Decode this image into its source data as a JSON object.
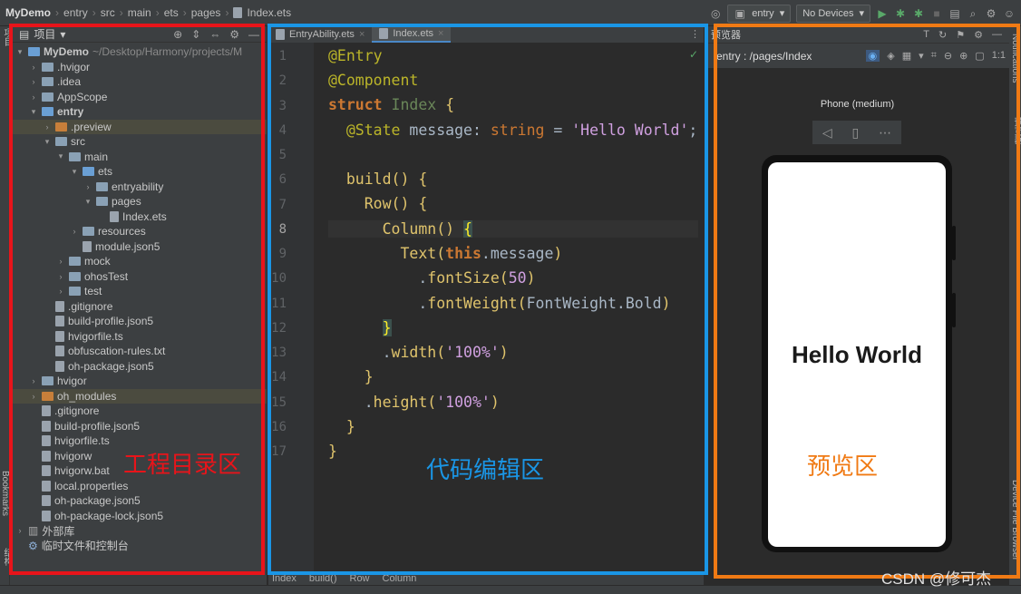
{
  "topbar": {
    "crumbs": [
      "MyDemo",
      "entry",
      "src",
      "main",
      "ets",
      "pages",
      "Index.ets"
    ],
    "run_config": "entry",
    "device": "No Devices"
  },
  "project": {
    "title": "项目",
    "tree": [
      {
        "label": "MyDemo",
        "extra": "~/Desktop/Harmony/projects/M",
        "depth": 0,
        "arrow": "down",
        "kind": "folder-blue",
        "bold": true
      },
      {
        "label": ".hvigor",
        "depth": 1,
        "arrow": "right",
        "kind": "folder"
      },
      {
        "label": ".idea",
        "depth": 1,
        "arrow": "right",
        "kind": "folder"
      },
      {
        "label": "AppScope",
        "depth": 1,
        "arrow": "right",
        "kind": "folder"
      },
      {
        "label": "entry",
        "depth": 1,
        "arrow": "down",
        "kind": "folder-blue",
        "bold": true
      },
      {
        "label": ".preview",
        "depth": 2,
        "arrow": "right",
        "kind": "folder-orange",
        "hl": true
      },
      {
        "label": "src",
        "depth": 2,
        "arrow": "down",
        "kind": "folder"
      },
      {
        "label": "main",
        "depth": 3,
        "arrow": "down",
        "kind": "folder"
      },
      {
        "label": "ets",
        "depth": 4,
        "arrow": "down",
        "kind": "folder-blue"
      },
      {
        "label": "entryability",
        "depth": 5,
        "arrow": "right",
        "kind": "folder"
      },
      {
        "label": "pages",
        "depth": 5,
        "arrow": "down",
        "kind": "folder"
      },
      {
        "label": "Index.ets",
        "depth": 6,
        "arrow": "",
        "kind": "file"
      },
      {
        "label": "resources",
        "depth": 4,
        "arrow": "right",
        "kind": "folder"
      },
      {
        "label": "module.json5",
        "depth": 4,
        "arrow": "",
        "kind": "file"
      },
      {
        "label": "mock",
        "depth": 3,
        "arrow": "right",
        "kind": "folder"
      },
      {
        "label": "ohosTest",
        "depth": 3,
        "arrow": "right",
        "kind": "folder"
      },
      {
        "label": "test",
        "depth": 3,
        "arrow": "right",
        "kind": "folder"
      },
      {
        "label": ".gitignore",
        "depth": 2,
        "arrow": "",
        "kind": "file"
      },
      {
        "label": "build-profile.json5",
        "depth": 2,
        "arrow": "",
        "kind": "file"
      },
      {
        "label": "hvigorfile.ts",
        "depth": 2,
        "arrow": "",
        "kind": "file"
      },
      {
        "label": "obfuscation-rules.txt",
        "depth": 2,
        "arrow": "",
        "kind": "file"
      },
      {
        "label": "oh-package.json5",
        "depth": 2,
        "arrow": "",
        "kind": "file"
      },
      {
        "label": "hvigor",
        "depth": 1,
        "arrow": "right",
        "kind": "folder"
      },
      {
        "label": "oh_modules",
        "depth": 1,
        "arrow": "right",
        "kind": "folder-orange",
        "hl": true
      },
      {
        "label": ".gitignore",
        "depth": 1,
        "arrow": "",
        "kind": "file"
      },
      {
        "label": "build-profile.json5",
        "depth": 1,
        "arrow": "",
        "kind": "file"
      },
      {
        "label": "hvigorfile.ts",
        "depth": 1,
        "arrow": "",
        "kind": "file"
      },
      {
        "label": "hvigorw",
        "depth": 1,
        "arrow": "",
        "kind": "file"
      },
      {
        "label": "hvigorw.bat",
        "depth": 1,
        "arrow": "",
        "kind": "file"
      },
      {
        "label": "local.properties",
        "depth": 1,
        "arrow": "",
        "kind": "file"
      },
      {
        "label": "oh-package.json5",
        "depth": 1,
        "arrow": "",
        "kind": "file"
      },
      {
        "label": "oh-package-lock.json5",
        "depth": 1,
        "arrow": "",
        "kind": "file"
      },
      {
        "label": "外部库",
        "depth": 0,
        "arrow": "right",
        "kind": "lib"
      },
      {
        "label": "临时文件和控制台",
        "depth": 0,
        "arrow": "",
        "kind": "console"
      }
    ]
  },
  "editor": {
    "tabs": [
      "EntryAbility.ets",
      "Index.ets"
    ],
    "line_numbers": [
      "1",
      "2",
      "3",
      "4",
      "5",
      "6",
      "7",
      "8",
      "9",
      "10",
      "11",
      "12",
      "13",
      "14",
      "15",
      "16",
      "17"
    ],
    "breadcrumb": [
      "Index",
      "build()",
      "Row",
      "Column"
    ]
  },
  "preview": {
    "title": "预览器",
    "path": "entry : /pages/Index",
    "device": "Phone (medium)",
    "screen_text": "Hello World"
  },
  "side": {
    "left_project": "项目",
    "left_bookmarks": "Bookmarks",
    "left_structure": "结构",
    "right_notifications": "Notifications",
    "right_preview": "预览器",
    "right_device_file": "Device File Browser"
  },
  "annotations": {
    "project_zone": "工程目录区",
    "editor_zone": "代码编辑区",
    "preview_zone": "预览区",
    "watermark": "CSDN @修可杰"
  },
  "colors": {
    "project_box": "#e8141a",
    "editor_box": "#1a96e6",
    "preview_box": "#f07a14"
  }
}
